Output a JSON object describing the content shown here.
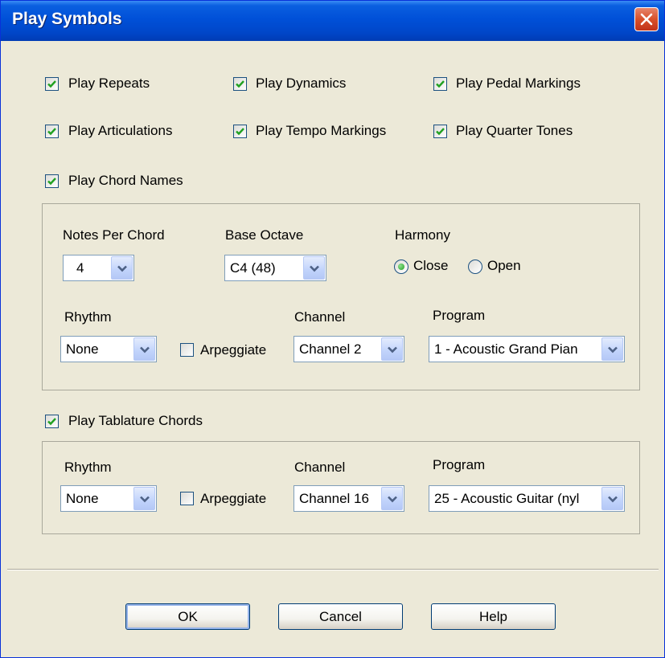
{
  "window": {
    "title": "Play Symbols"
  },
  "checkboxes": {
    "play_repeats": "Play Repeats",
    "play_dynamics": "Play Dynamics",
    "play_pedal_markings": "Play Pedal Markings",
    "play_articulations": "Play Articulations",
    "play_tempo_markings": "Play Tempo Markings",
    "play_quarter_tones": "Play Quarter Tones",
    "play_chord_names": "Play Chord Names",
    "play_tablature_chords": "Play Tablature Chords"
  },
  "chord_names": {
    "notes_per_chord_label": "Notes Per Chord",
    "notes_per_chord_value": "4",
    "base_octave_label": "Base Octave",
    "base_octave_value": "C4 (48)",
    "harmony_label": "Harmony",
    "harmony_close": "Close",
    "harmony_open": "Open",
    "rhythm_label": "Rhythm",
    "rhythm_value": "None",
    "arpeggiate_label": "Arpeggiate",
    "channel_label": "Channel",
    "channel_value": "Channel 2",
    "program_label": "Program",
    "program_value": "1 - Acoustic Grand Pian"
  },
  "tablature_chords": {
    "rhythm_label": "Rhythm",
    "rhythm_value": "None",
    "arpeggiate_label": "Arpeggiate",
    "channel_label": "Channel",
    "channel_value": "Channel 16",
    "program_label": "Program",
    "program_value": "25 - Acoustic Guitar (nyl"
  },
  "buttons": {
    "ok": "OK",
    "cancel": "Cancel",
    "help": "Help"
  },
  "colors": {
    "title_bar": "#0050d8",
    "dialog_bg": "#ece9d8",
    "check_green": "#21a121",
    "close_button": "#d9502a"
  }
}
